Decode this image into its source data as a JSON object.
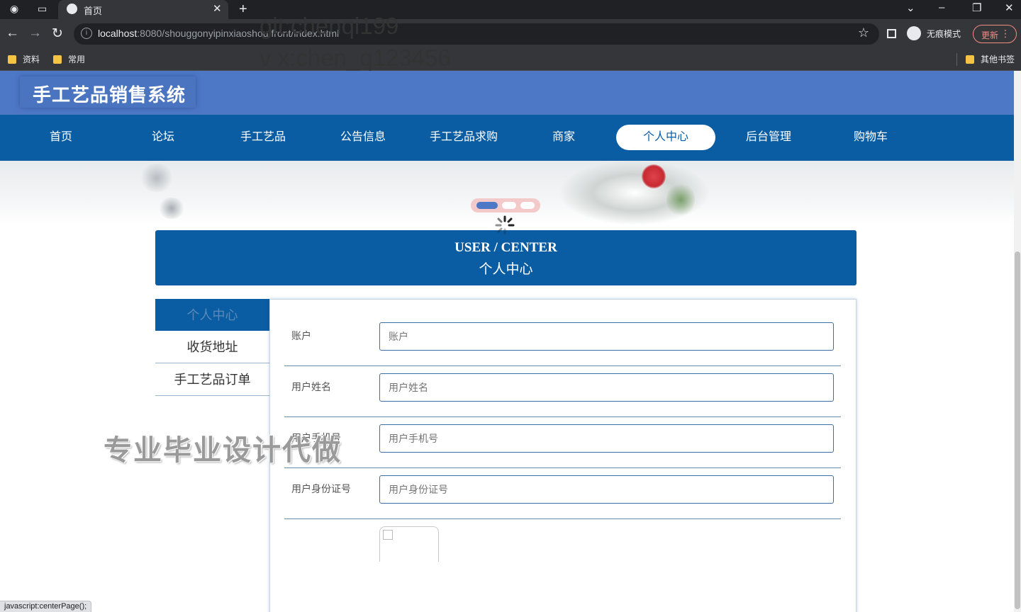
{
  "browser": {
    "tab_title": "首页",
    "url_host": "localhost",
    "url_rest": ":8080/shouggonyipinxiaoshou/front/index.html",
    "incognito_label": "无痕模式",
    "update_label": "更新",
    "bookmarks": [
      "资料",
      "常用"
    ],
    "other_bookmarks": "其他书签",
    "status_text": "javascript:centerPage();"
  },
  "site": {
    "title": "手工艺品销售系统",
    "nav": [
      {
        "label": "首页",
        "active": false
      },
      {
        "label": "论坛",
        "active": false
      },
      {
        "label": "手工艺品",
        "active": false
      },
      {
        "label": "公告信息",
        "active": false
      },
      {
        "label": "手工艺品求购",
        "active": false
      },
      {
        "label": "商家",
        "active": false
      },
      {
        "label": "个人中心",
        "active": true
      },
      {
        "label": "后台管理",
        "active": false
      },
      {
        "label": "购物车",
        "active": false
      }
    ]
  },
  "watermark": {
    "line1": "git:chenqi199",
    "line2": "v x:chen_q123456",
    "overlay": "专业毕业设计代做"
  },
  "user_center": {
    "title_en": "USER / CENTER",
    "title_cn": "个人中心"
  },
  "sidebar": {
    "items": [
      {
        "label": "个人中心",
        "active": true
      },
      {
        "label": "收货地址",
        "active": false
      },
      {
        "label": "手工艺品订单",
        "active": false
      }
    ]
  },
  "form": {
    "fields": [
      {
        "label": "账户",
        "placeholder": "账户",
        "value": ""
      },
      {
        "label": "用户姓名",
        "placeholder": "用户姓名",
        "value": ""
      },
      {
        "label": "用户手机号",
        "placeholder": "用户手机号",
        "value": ""
      },
      {
        "label": "用户身份证号",
        "placeholder": "用户身份证号",
        "value": ""
      }
    ]
  },
  "colors": {
    "banner": "#4d78c6",
    "nav": "#0b5da3",
    "accent": "#0b5da3"
  }
}
